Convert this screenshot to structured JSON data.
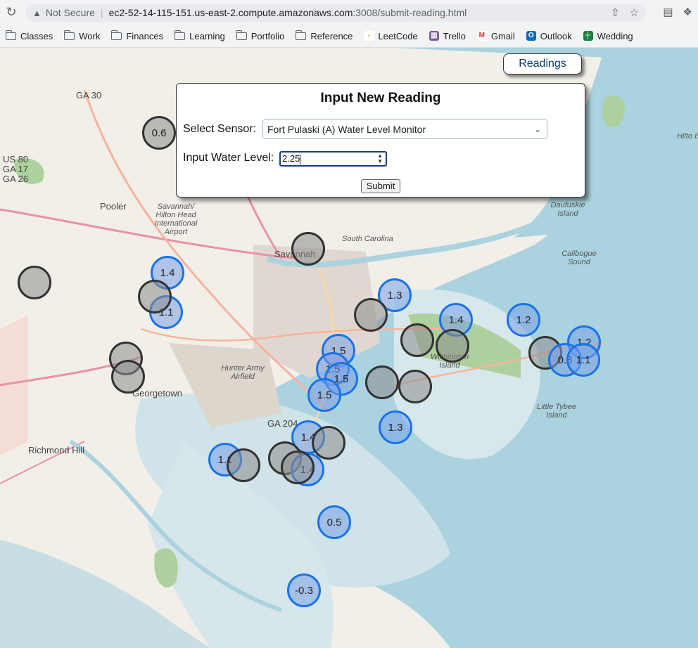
{
  "browser": {
    "security": "Not Secure",
    "url_host": "ec2-52-14-115-151.us-east-2.compute.amazonaws.com",
    "url_path": ":3008/submit-reading.html",
    "bookmarks": [
      {
        "label": "Classes",
        "icon": "folder-icon"
      },
      {
        "label": "Work",
        "icon": "folder-icon"
      },
      {
        "label": "Finances",
        "icon": "folder-icon"
      },
      {
        "label": "Learning",
        "icon": "folder-icon"
      },
      {
        "label": "Portfolio",
        "icon": "folder-icon"
      },
      {
        "label": "Reference",
        "icon": "folder-icon"
      },
      {
        "label": "LeetCode",
        "icon": "leetcode-icon"
      },
      {
        "label": "Trello",
        "icon": "trello-icon"
      },
      {
        "label": "Gmail",
        "icon": "gmail-icon"
      },
      {
        "label": "Outlook",
        "icon": "outlook-icon"
      },
      {
        "label": "Wedding",
        "icon": "sheets-icon"
      }
    ]
  },
  "nav": {
    "readings_label": "Readings"
  },
  "form": {
    "title": "Input New Reading",
    "sensor_label": "Select Sensor:",
    "sensor_value": "Fort Pulaski (A) Water Level Monitor",
    "level_label": "Input Water Level:",
    "level_value": "2.25",
    "submit_label": "Submit"
  },
  "map": {
    "places": [
      {
        "name": "GA 30",
        "cls": "city"
      },
      {
        "name": "US 80",
        "cls": "city"
      },
      {
        "name": "GA 17",
        "cls": "city"
      },
      {
        "name": "GA 26",
        "cls": "city"
      },
      {
        "name": "Pooler",
        "cls": "city"
      },
      {
        "name": "Savannah/ Hilton Head International Airport",
        "cls": ""
      },
      {
        "name": "Savannah",
        "cls": "city"
      },
      {
        "name": "South Carolina",
        "cls": ""
      },
      {
        "name": "Daufuskie Island",
        "cls": ""
      },
      {
        "name": "Calibogue Sound",
        "cls": ""
      },
      {
        "name": "Hunter Army Airfield",
        "cls": ""
      },
      {
        "name": "Georgetown",
        "cls": "city"
      },
      {
        "name": "Wilmington Island",
        "cls": ""
      },
      {
        "name": "Little Tybee Island",
        "cls": ""
      },
      {
        "name": "Richmond Hill",
        "cls": "city"
      },
      {
        "name": "GA 204",
        "cls": "city"
      },
      {
        "name": "Hilto Is",
        "cls": ""
      }
    ],
    "markers": [
      {
        "label": "0.6",
        "color": "gray"
      },
      {
        "label": "",
        "color": "gray"
      },
      {
        "label": "1.4",
        "color": "blue"
      },
      {
        "label": "1.1",
        "color": "blue"
      },
      {
        "label": "",
        "color": "gray"
      },
      {
        "label": "",
        "color": "gray"
      },
      {
        "label": "",
        "color": "gray"
      },
      {
        "label": "",
        "color": "gray"
      },
      {
        "label": "1.3",
        "color": "blue"
      },
      {
        "label": "",
        "color": "gray"
      },
      {
        "label": "1.4",
        "color": "blue"
      },
      {
        "label": "",
        "color": "gray"
      },
      {
        "label": "",
        "color": "gray"
      },
      {
        "label": "1.2",
        "color": "blue"
      },
      {
        "label": "",
        "color": "gray"
      },
      {
        "label": "1.2",
        "color": "blue"
      },
      {
        "label": "0.8",
        "color": "blue"
      },
      {
        "label": "1.1",
        "color": "blue"
      },
      {
        "label": "1.5",
        "color": "blue"
      },
      {
        "label": "1.5",
        "color": "blue"
      },
      {
        "label": "1.5",
        "color": "blue"
      },
      {
        "label": "1.5",
        "color": "blue"
      },
      {
        "label": "",
        "color": "gray"
      },
      {
        "label": "",
        "color": "gray"
      },
      {
        "label": "1.3",
        "color": "blue"
      },
      {
        "label": "1.4",
        "color": "blue"
      },
      {
        "label": "",
        "color": "gray"
      },
      {
        "label": "",
        "color": "gray"
      },
      {
        "label": "1.4",
        "color": "blue"
      },
      {
        "label": "",
        "color": "gray"
      },
      {
        "label": "1.1",
        "color": "blue"
      },
      {
        "label": "",
        "color": "gray"
      },
      {
        "label": "0.5",
        "color": "blue"
      },
      {
        "label": "-0.3",
        "color": "blue"
      }
    ]
  }
}
